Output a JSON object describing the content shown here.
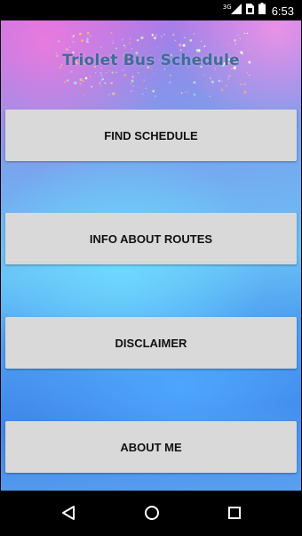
{
  "status_bar": {
    "network_label": "3G",
    "time": "6:53"
  },
  "app": {
    "title": "Triolet Bus Schedule"
  },
  "menu": {
    "find_schedule": "FIND SCHEDULE",
    "info_about_routes": "INFO ABOUT ROUTES",
    "disclaimer": "DISCLAIMER",
    "about_me": "ABOUT ME"
  },
  "colors": {
    "button_bg": "#d9d9d9",
    "title_color": "#3f6d96",
    "status_bar_bg": "#000000"
  },
  "icons": {
    "status": [
      "signal-icon",
      "sim-icon",
      "battery-icon"
    ],
    "nav": [
      "back-icon",
      "home-icon",
      "recents-icon"
    ]
  }
}
